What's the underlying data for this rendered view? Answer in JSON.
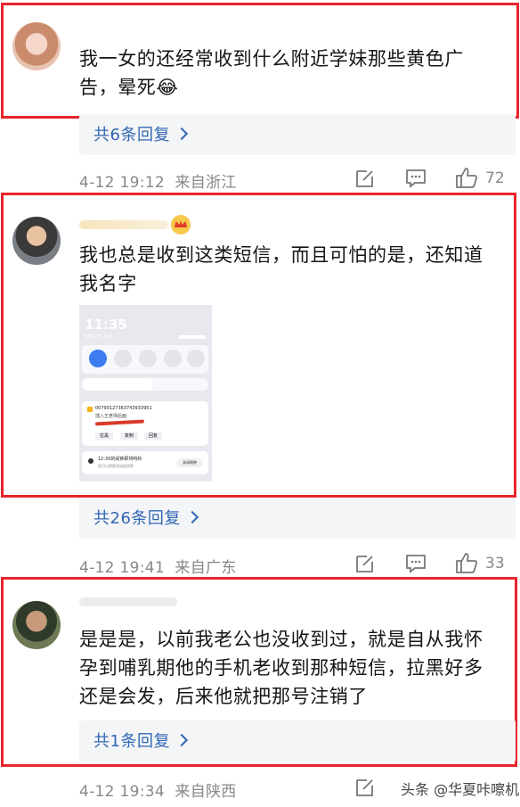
{
  "comments": [
    {
      "text_line1": "我一女的还经常收到什么附近学妹那些黄色广",
      "text_line2": "告，晕死😂",
      "reply_link": "共6条回复",
      "date": "4-12 19:12",
      "location": "来自浙江",
      "likes": "72"
    },
    {
      "text_line1": "我也总是收到这类短信，而且可怕的是，还知道",
      "text_line2": "我名字",
      "reply_link": "共26条回复",
      "date": "4-12 19:41",
      "location": "来自广东",
      "likes": "33",
      "screenshot": {
        "time": "11:35",
        "date": "5月27日 周五",
        "sms_number": "00790127363743933951",
        "sms_preview": "插入王老师后面",
        "btn1": "拉黑",
        "btn2": "复制",
        "btn3": "回复",
        "alarm_title": "12:30的闹钟即将响铃",
        "alarm_sub": "您可以提前关闭此闹钟",
        "alarm_btn": "关闭闹钟"
      }
    },
    {
      "text_line1": "是是是，以前我老公也没收到过，就是自从我怀",
      "text_line2": "孕到哺乳期他的手机老收到那种短信，拉黑好多",
      "text_line3": "还是会发，后来他就把那号注销了",
      "reply_link": "共1条回复",
      "date": "4-12 19:34",
      "location": "来自陕西"
    }
  ],
  "watermark": "头条 @华夏咔嚓机",
  "colors": {
    "highlight": "#e8262b",
    "link": "#2f66b3",
    "meta": "#888888"
  }
}
